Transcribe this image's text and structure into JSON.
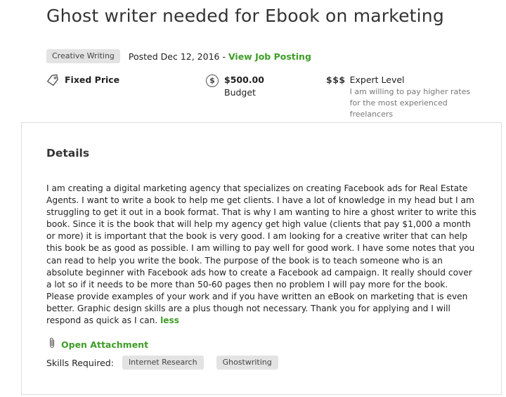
{
  "job": {
    "title": "Ghost writer needed for Ebook on marketing",
    "category": "Creative Writing",
    "posted_text": "Posted Dec 12, 2016 - ",
    "view_link": "View Job Posting"
  },
  "info": {
    "price_type": "Fixed Price",
    "budget_amount": "$500.00",
    "budget_label": "Budget",
    "level_symbol": "$$$",
    "level_title": "Expert Level",
    "level_desc": "I am willing to pay higher rates for the most experienced freelancers"
  },
  "details": {
    "heading": "Details",
    "description": "I am creating a digital marketing agency that specializes on creating Facebook ads for Real Estate Agents. I want to write a book to help me get clients. I have a lot of knowledge in my head but I am struggling to get it out in a book format. That is why I am wanting to hire a ghost writer to write this book. Since it is the book that will help my agency get high value (clients that pay $1,000 a month or more) it is important that the book is very good. I am looking for a creative writer that can help this book be as good as possible. I am willing to pay well for good work. I have some notes that you can read to help you write the book. The purpose of the book is to teach someone who is an absolute beginner with Facebook ads how to create a Facebook ad campaign.  It really should cover a lot so if it needs to be more than 50-60 pages then no problem I will pay more for the book. Please provide examples of your work and if you have written an eBook on marketing that is even better. Graphic design skills are a plus though not necessary. Thank you for applying and I will respond as quick as I can. ",
    "less_link": "less",
    "attachment_link": "Open Attachment",
    "skills_label": "Skills Required:",
    "skills": [
      "Internet Research",
      "Ghostwriting"
    ]
  },
  "colors": {
    "accent_green": "#3e9d28",
    "chip_bg": "#e3e3e3"
  },
  "icons": {
    "price": "price-tag-icon",
    "budget": "dollar-circle-icon",
    "attachment": "paperclip-icon"
  }
}
